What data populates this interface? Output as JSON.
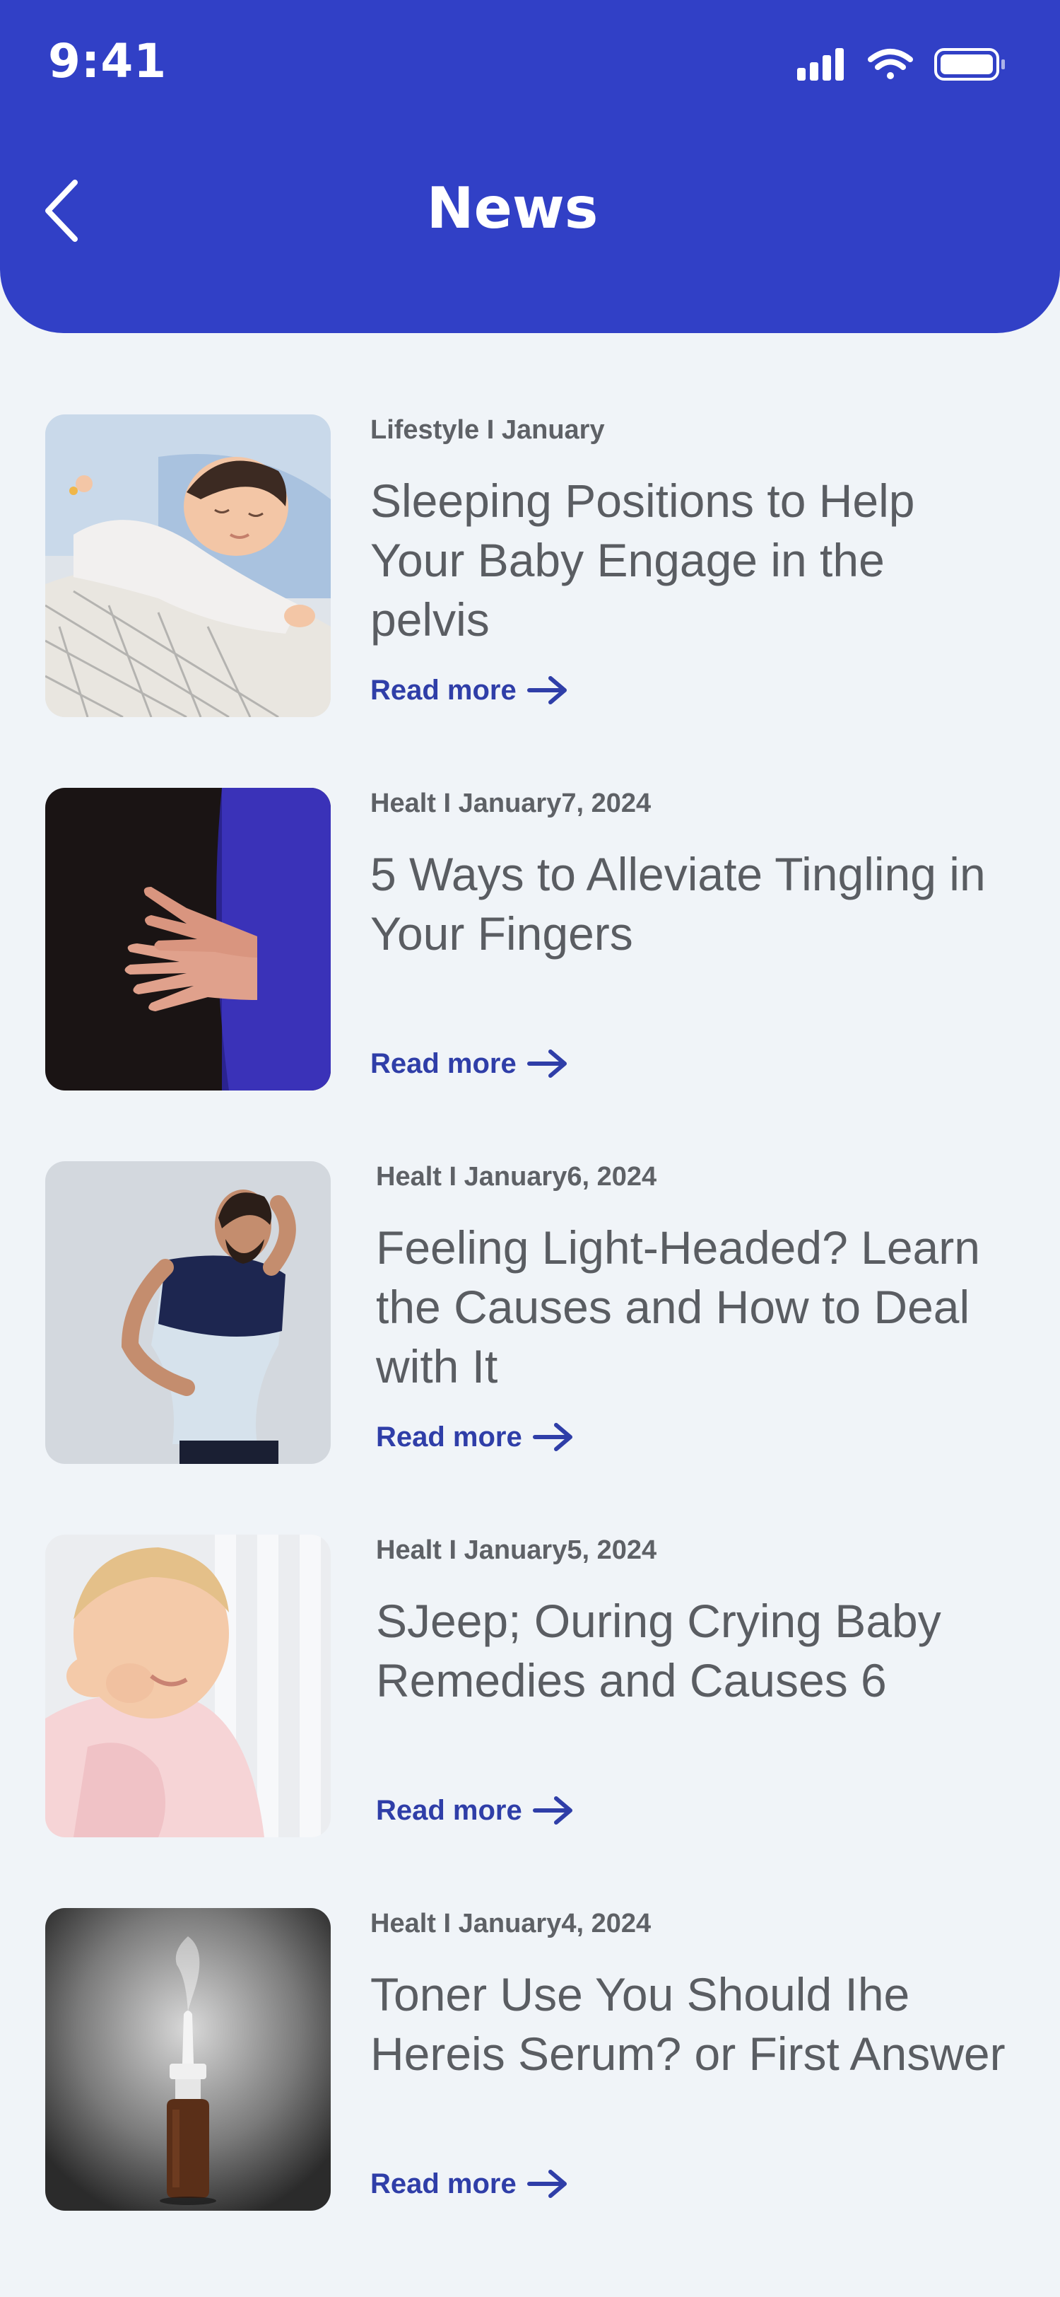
{
  "status_bar": {
    "time": "9:41"
  },
  "header": {
    "title": "News",
    "back_icon": "chevron-left-icon"
  },
  "articles": [
    {
      "meta": "Lifestyle I January",
      "headline": "Sleeping Positions to Help Your Baby Engage in the pelvis",
      "read_more": "Read more",
      "image": "sleeping-baby-photo"
    },
    {
      "meta": "Healt I January7, 2024",
      "headline": "5 Ways to Alleviate Tingling in Your Fingers",
      "read_more": "Read more",
      "image": "hands-rubbing-photo"
    },
    {
      "meta": "Healt I January6, 2024",
      "headline": "Feeling Light-Headed? Learn the Causes and How to Deal with It",
      "read_more": "Read more",
      "image": "dizzy-man-photo"
    },
    {
      "meta": "Healt I January5, 2024",
      "headline": "SJeep; Ouring Crying Baby Remedies and Causes 6",
      "read_more": "Read more",
      "image": "crying-baby-photo"
    },
    {
      "meta": "Healt I January4, 2024",
      "headline": "Toner Use You Should Ihe Hereis Serum? or First Answer",
      "read_more": "Read more",
      "image": "nasal-spray-photo"
    }
  ],
  "colors": {
    "header": "#3140c6",
    "link": "#2f3ea8",
    "background": "#f0f4f8"
  }
}
